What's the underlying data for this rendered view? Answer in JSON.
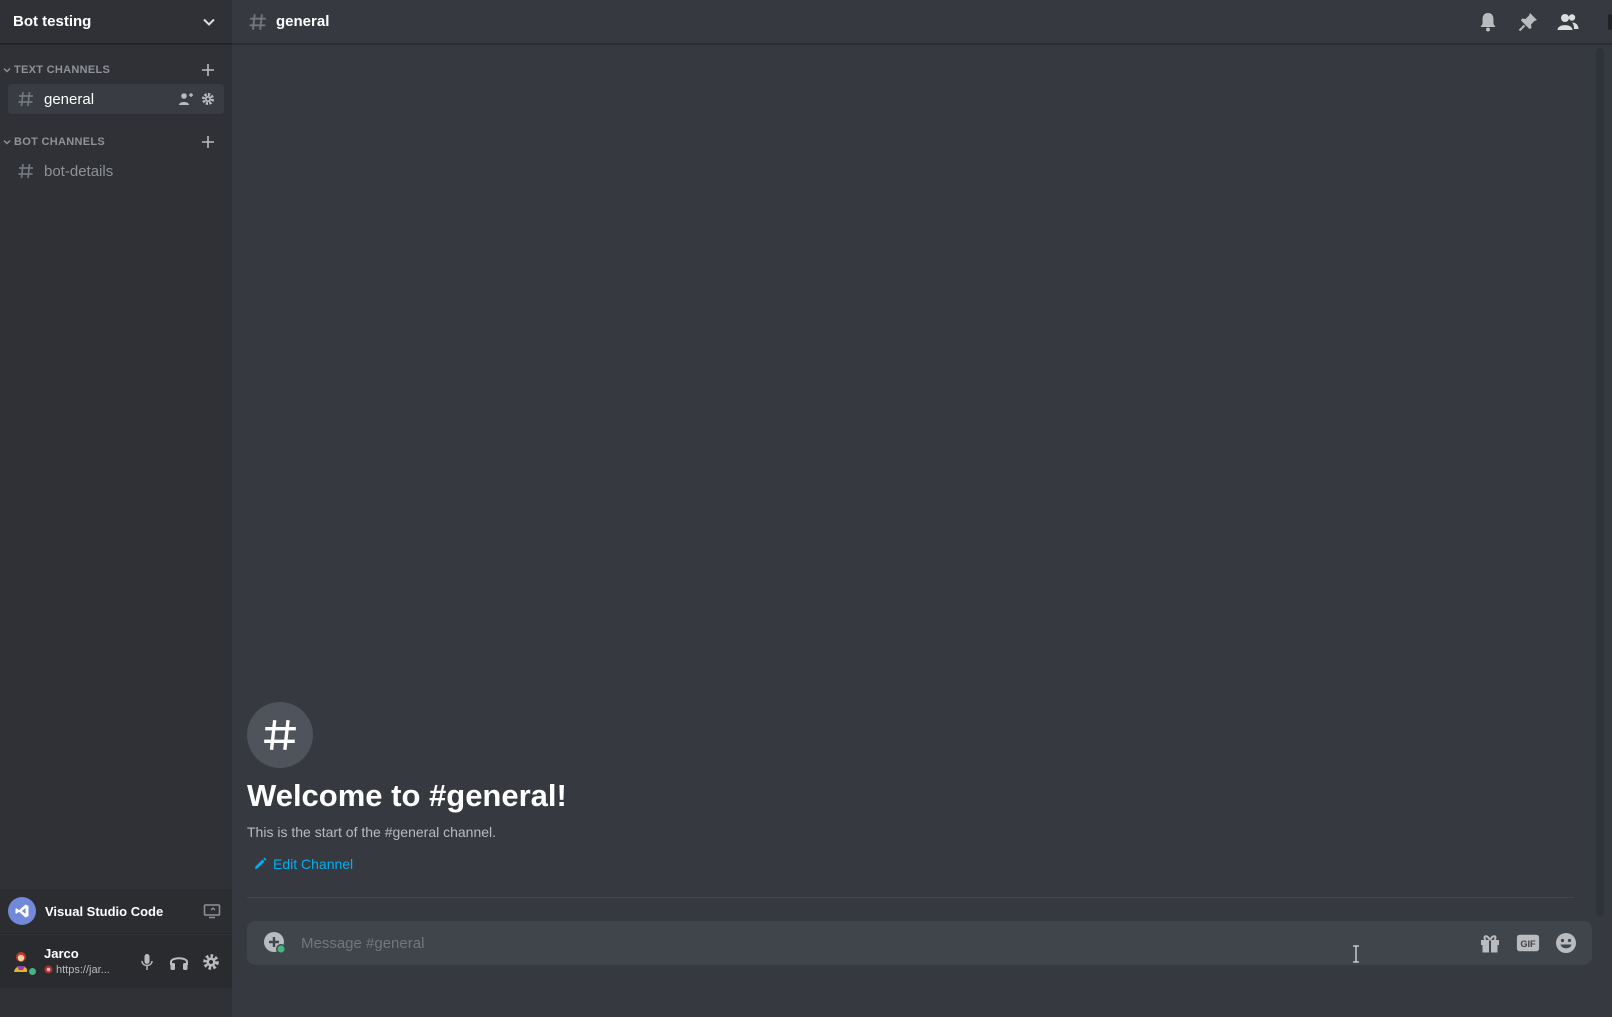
{
  "server": {
    "name": "Bot testing"
  },
  "categories": [
    {
      "label": "TEXT CHANNELS",
      "channels": [
        {
          "name": "general",
          "active": true
        }
      ]
    },
    {
      "label": "BOT CHANNELS",
      "channels": [
        {
          "name": "bot-details",
          "active": false
        }
      ]
    }
  ],
  "activity": {
    "name": "Visual Studio Code"
  },
  "user": {
    "name": "Jarco",
    "status": "https://jar..."
  },
  "header": {
    "hash": "#",
    "channel": "general"
  },
  "welcome": {
    "icon": "#",
    "title": "Welcome to #general!",
    "subtitle": "This is the start of the #general channel.",
    "edit_label": "Edit Channel"
  },
  "composer": {
    "placeholder": "Message #general",
    "gif_label": "GIF"
  },
  "colors": {
    "accent": "#00b0f4",
    "online": "#43b581",
    "blurple": "#7289da"
  }
}
